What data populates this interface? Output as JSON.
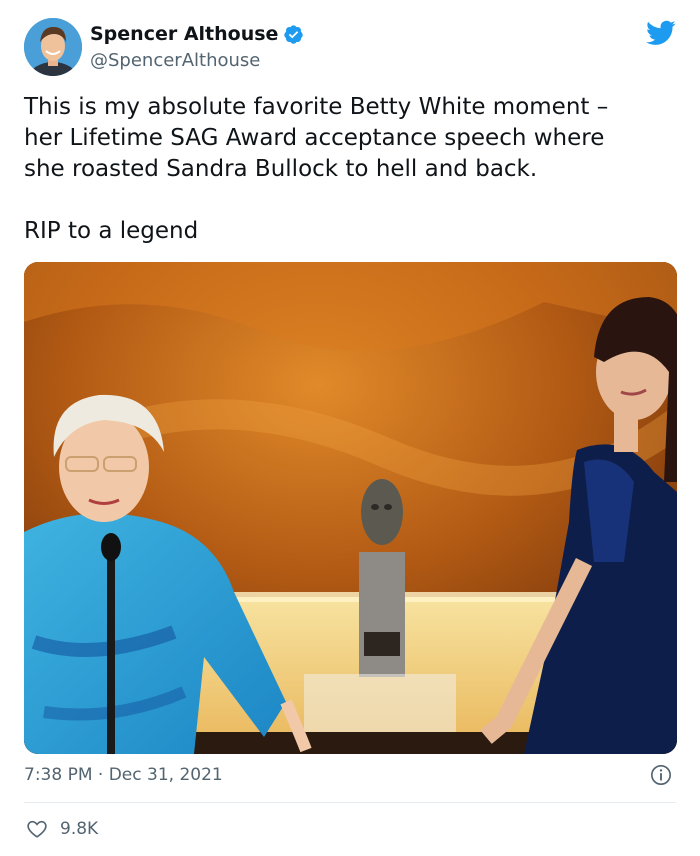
{
  "tweet": {
    "author_name": "Spencer Althouse",
    "handle": "@SpencerAlthouse",
    "verified": true,
    "text": "This is my absolute favorite Betty White moment –\nher Lifetime SAG Award acceptance speech where\nshe roasted Sandra Bullock to hell and back.\n\nRIP to a legend",
    "timestamp": "7:38 PM · Dec 31, 2021",
    "like_count": "9.8K"
  },
  "icons": {
    "verified": "verified-badge-icon",
    "platform": "twitter-bird-icon",
    "info": "info-icon",
    "like": "heart-icon"
  },
  "colors": {
    "brand": "#1d9bf0",
    "text": "#0f1419",
    "secondary_text": "#536471"
  }
}
